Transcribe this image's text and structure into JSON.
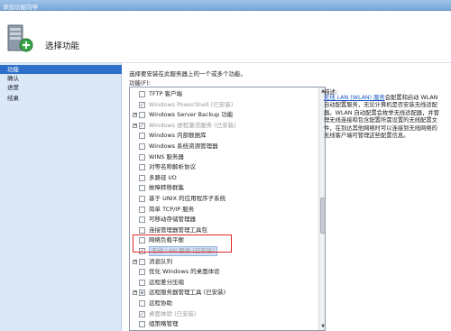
{
  "window": {
    "title": "添加功能向导"
  },
  "header": {
    "title": "选择功能",
    "icon": "wizard-server-icon"
  },
  "nav": {
    "items": [
      "功能",
      "确认",
      "进度",
      "结果"
    ],
    "active_index": 0
  },
  "main": {
    "description": "选择要安装在此服务器上的一个或多个功能。",
    "features_label": "功能(F):",
    "features": [
      {
        "label": "TFTP 客户端",
        "checked": false,
        "disabled": false,
        "expander": ""
      },
      {
        "label": "Windows PowerShell (已安装)",
        "checked": true,
        "disabled": true,
        "expander": ""
      },
      {
        "label": "Windows Server Backup 功能",
        "checked": false,
        "disabled": false,
        "expander": "+"
      },
      {
        "label": "Windows 进程激活服务 (已安装)",
        "checked": true,
        "disabled": true,
        "expander": "+"
      },
      {
        "label": "Windows 内部数据库",
        "checked": false,
        "disabled": false,
        "expander": ""
      },
      {
        "label": "Windows 系统资源管理器",
        "checked": false,
        "disabled": false,
        "expander": ""
      },
      {
        "label": "WINS 服务器",
        "checked": false,
        "disabled": false,
        "expander": ""
      },
      {
        "label": "对等名称解析协议",
        "checked": false,
        "disabled": false,
        "expander": ""
      },
      {
        "label": "多路径 I/O",
        "checked": false,
        "disabled": false,
        "expander": ""
      },
      {
        "label": "故障转移群集",
        "checked": false,
        "disabled": false,
        "expander": ""
      },
      {
        "label": "基于 UNIX 的应用程序子系统",
        "checked": false,
        "disabled": false,
        "expander": ""
      },
      {
        "label": "简单 TCP/IP 服务",
        "checked": false,
        "disabled": false,
        "expander": ""
      },
      {
        "label": "可移动存储管理器",
        "checked": false,
        "disabled": false,
        "expander": ""
      },
      {
        "label": "连接管理器管理工具包",
        "checked": false,
        "disabled": false,
        "expander": ""
      },
      {
        "label": "网络负载平衡",
        "checked": false,
        "disabled": false,
        "expander": ""
      },
      {
        "label": "无线 LAN 服务 (已安装)",
        "checked": true,
        "disabled": true,
        "expander": "",
        "selected": true
      },
      {
        "label": "消息队列",
        "checked": false,
        "disabled": false,
        "expander": "+"
      },
      {
        "label": "优化 Windows 的桌面体验",
        "checked": false,
        "disabled": false,
        "expander": ""
      },
      {
        "label": "远程差分压缩",
        "checked": false,
        "disabled": false,
        "expander": ""
      },
      {
        "label": "远程服务器管理工具 (已安装)",
        "checked": false,
        "partial": true,
        "disabled": false,
        "expander": "+"
      },
      {
        "label": "远程协助",
        "checked": false,
        "disabled": false,
        "expander": ""
      },
      {
        "label": "桌面体验 (已安装)",
        "checked": true,
        "disabled": true,
        "expander": ""
      },
      {
        "label": "组策略管理",
        "checked": false,
        "disabled": false,
        "expander": ""
      }
    ]
  },
  "description_panel": {
    "title": "描述:",
    "link": "无线 LAN (WLAN) 服务",
    "text": "会配置和启动 WLAN 自动配置服务，无论计算机是否安装无线适配器。WLAN 自动配置会枚举无线适配器，并管理无线连接和包含配置所需设置的无线配置文件，在到达其他网络时可以连接到无线网络的无线客户端可管理这些配置信息。"
  },
  "colors": {
    "nav_active": "#2e6fc9",
    "highlight": "#e0282a",
    "link": "#1a56c6"
  }
}
